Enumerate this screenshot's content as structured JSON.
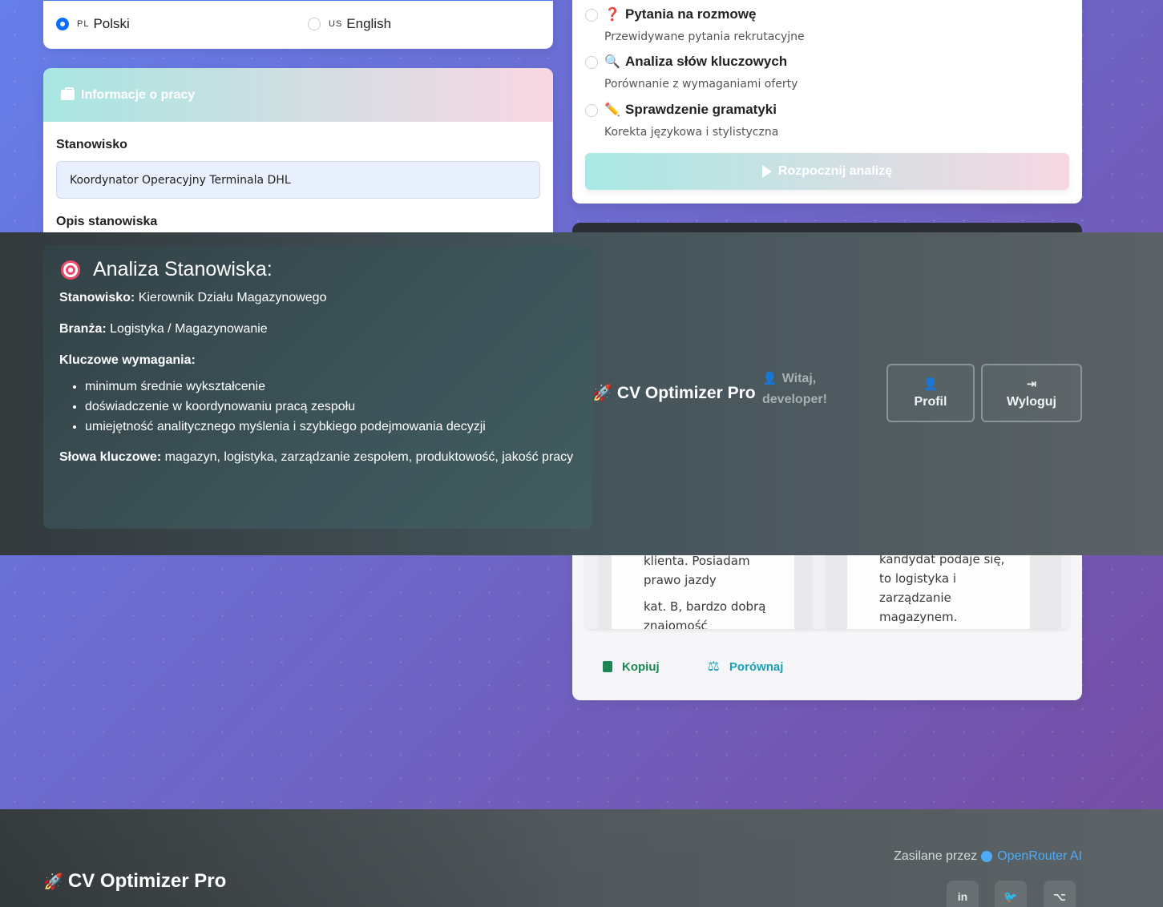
{
  "language": {
    "options": [
      {
        "flag": "PL",
        "label": "Polski",
        "selected": true
      },
      {
        "flag": "US",
        "label": "English",
        "selected": false
      }
    ]
  },
  "job": {
    "header": "Informacje o pracy",
    "position_label": "Stanowisko",
    "position_value": "Koordynator Operacyjny Terminala DHL",
    "description_label": "Opis stanowiska"
  },
  "analysis_options": [
    {
      "icon": "question-icon",
      "emoji": "❓",
      "title": "Pytania na rozmowę",
      "desc": "Przewidywane pytania rekrutacyjne"
    },
    {
      "icon": "magnifier-icon",
      "emoji": "🔍",
      "title": "Analiza słów kluczowych",
      "desc": "Porównanie z wymaganiami oferty"
    },
    {
      "icon": "pencil-icon",
      "emoji": "✏️",
      "title": "Sprawdzenie gramatyki",
      "desc": "Korekta językowa i stylistyczna"
    }
  ],
  "start_button": "Rozpocznij analizę",
  "job_analysis": {
    "title": "Analiza Stanowiska:",
    "position_key": "Stanowisko:",
    "position_val": "Kierownik Działu Magazynowego",
    "industry_key": "Branża:",
    "industry_val": "Logistyka / Magazynowanie",
    "requirements_key": "Kluczowe wymagania:",
    "requirements": [
      "minimum średnie wykształcenie",
      "doświadczenie w koordynowaniu pracą zespołu",
      "umiejętność analitycznego myślenia i szybkiego podejmowania decyzji"
    ],
    "keywords_key": "Słowa kluczowe:",
    "keywords_val": "magazyn, logistyka, zarządzanie zespołem, produktowość, jakość pracy"
  },
  "navbar": {
    "brand": "CV Optimizer Pro",
    "welcome_line1": "Witaj,",
    "welcome_line2": "developer!",
    "profile": "Profil",
    "logout": "Wyloguj"
  },
  "comparison": {
    "left_lines": [
      "klienta. Posiadam prawo jazdy",
      "kat. B, bardzo dobrą znajomość"
    ],
    "right_lines": [
      "kandydat podaje się, to logistyka i zarządzanie magazynem."
    ],
    "copy": "Kopiuj",
    "compare": "Porównaj"
  },
  "footer": {
    "brand": "CV Optimizer Pro",
    "powered_prefix": "Zasilane przez",
    "powered_link": "OpenRouter AI",
    "social": [
      "linkedin-icon",
      "twitter-icon",
      "github-icon"
    ]
  }
}
